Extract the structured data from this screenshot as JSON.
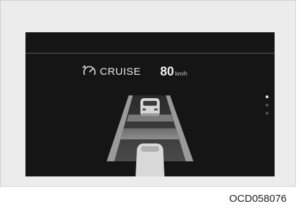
{
  "cluster": {
    "cruise_label": "CRUISE",
    "set_speed": "80",
    "speed_unit": "km/h",
    "icon": "cruise-control-icon",
    "page_indicator": {
      "total": 3,
      "active_index": 0
    },
    "colors": {
      "screen_background": "#151515",
      "text": "#e6e6e6",
      "lane": "#8a8a8a"
    }
  },
  "figure_code": "OCD058076"
}
